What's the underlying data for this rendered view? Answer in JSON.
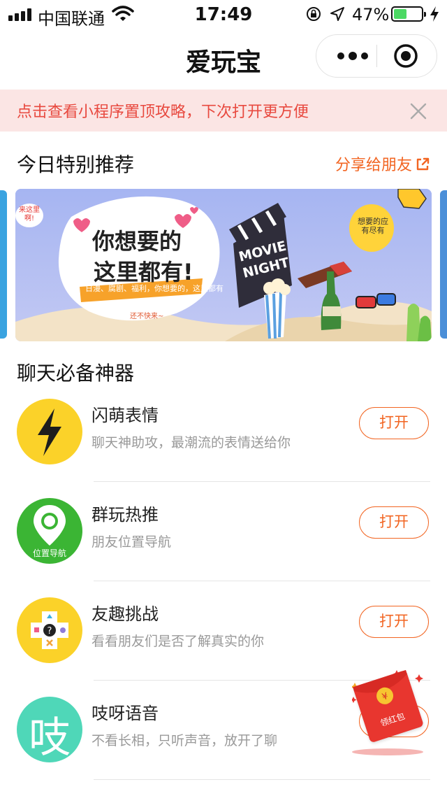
{
  "status_bar": {
    "carrier": "中国联通",
    "time": "17:49",
    "battery_pct": "47%",
    "battery_level": 0.47
  },
  "nav": {
    "title": "爱玩宝",
    "more_icon": "more-dots-icon",
    "close_icon": "target-close-icon"
  },
  "tip": {
    "text": "点击查看小程序置顶攻略，下次打开更方便",
    "close_icon": "close-icon"
  },
  "recommend": {
    "title": "今日特别推荐",
    "share_label": "分享给朋友",
    "banner": {
      "headline_1": "你想要的",
      "headline_2": "这里都有!",
      "ribbon": "日漫、腐剧、福利，你想要的，这里都有",
      "hurry": "还不快来~",
      "bubble_left": "来这里啊!",
      "bubble_right": "想要的应有尽有",
      "clapper": "MOVIE NIGHT"
    }
  },
  "chat_tools": {
    "title": "聊天必备神器",
    "items": [
      {
        "name": "闪萌表情",
        "desc": "聊天神助攻，最潮流的表情送给你",
        "button": "打开",
        "icon": "lightning-icon",
        "icon_color": "#fbd229"
      },
      {
        "name": "群玩热推",
        "desc": "朋友位置导航",
        "button": "打开",
        "icon": "location-pin-icon",
        "icon_label": "位置导航",
        "icon_color": "#3bb534"
      },
      {
        "name": "友趣挑战",
        "desc": "看看朋友们是否了解真实的你",
        "button": "打开",
        "icon": "game-pad-icon",
        "icon_color": "#fbd229"
      },
      {
        "name": "吱呀语音",
        "desc": "不看长相，只听声音，放开了聊",
        "button": "打开",
        "icon": "zhi-voice-icon",
        "icon_char": "吱",
        "icon_color": "#4fd7b8"
      }
    ]
  },
  "red_packet": {
    "label": "领红包",
    "symbol": "¥"
  },
  "colors": {
    "accent": "#f26522",
    "tip_bg": "#fbe5e4",
    "tip_text": "#e8493f"
  }
}
